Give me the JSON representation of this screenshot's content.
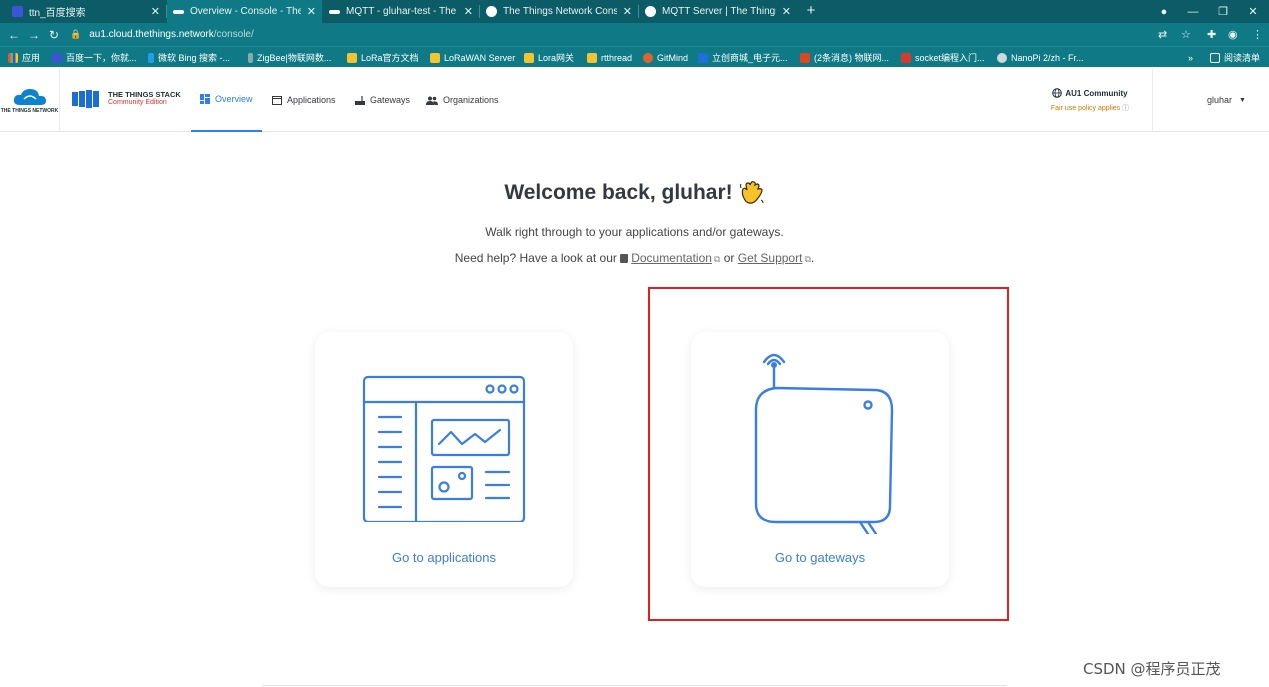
{
  "browser": {
    "tabs": [
      {
        "title": "ttn_百度搜索",
        "active": false
      },
      {
        "title": "Overview - Console - The Thi",
        "active": true
      },
      {
        "title": "MQTT - gluhar-test - The Thi",
        "active": false
      },
      {
        "title": "The Things Network Console",
        "active": false
      },
      {
        "title": "MQTT Server | The Things Stac",
        "active": false
      }
    ],
    "url_host": "au1.cloud.thethings.network",
    "url_path": "/console/",
    "bookmarks": [
      "应用",
      "百度一下，你就...",
      "微软 Bing 搜索 -...",
      "ZigBee|物联网数...",
      "LoRa官方文档",
      "LoRaWAN Server",
      "Lora网关",
      "rtthread",
      "GitMind",
      "立创商城_电子元...",
      "(2条消息) 物联网...",
      "socket编程入门...",
      "NanoPi 2/zh - Fr...",
      "阅读清单"
    ],
    "bookmarks_overflow": "»"
  },
  "header": {
    "ttn_logo_text": "THE THINGS NETWORK",
    "stack_title": "THE THINGS STACK",
    "stack_edition": "Community Edition",
    "nav": [
      {
        "label": "Overview",
        "active": true
      },
      {
        "label": "Applications",
        "active": false
      },
      {
        "label": "Gateways",
        "active": false
      },
      {
        "label": "Organizations",
        "active": false
      }
    ],
    "cluster_name": "AU1 Community",
    "cluster_note": "Fair use policy applies",
    "username": "gluhar"
  },
  "main": {
    "welcome": "Welcome back, gluhar!",
    "subtitle": "Walk right through to your applications and/or gateways.",
    "help_prefix": "Need help? Have a look at our",
    "doc_link": "Documentation",
    "help_or": "or",
    "support_link": "Get Support",
    "help_end": ".",
    "cards": [
      {
        "label": "Go to applications"
      },
      {
        "label": "Go to gateways"
      }
    ]
  },
  "watermark": "CSDN @程序员正茂",
  "colors": {
    "tab_strip": "#0b5c66",
    "toolbar": "#0f7a85",
    "accent_blue": "#2d7ff0",
    "highlight_red": "#e02020",
    "edition_red": "#e1322b"
  }
}
